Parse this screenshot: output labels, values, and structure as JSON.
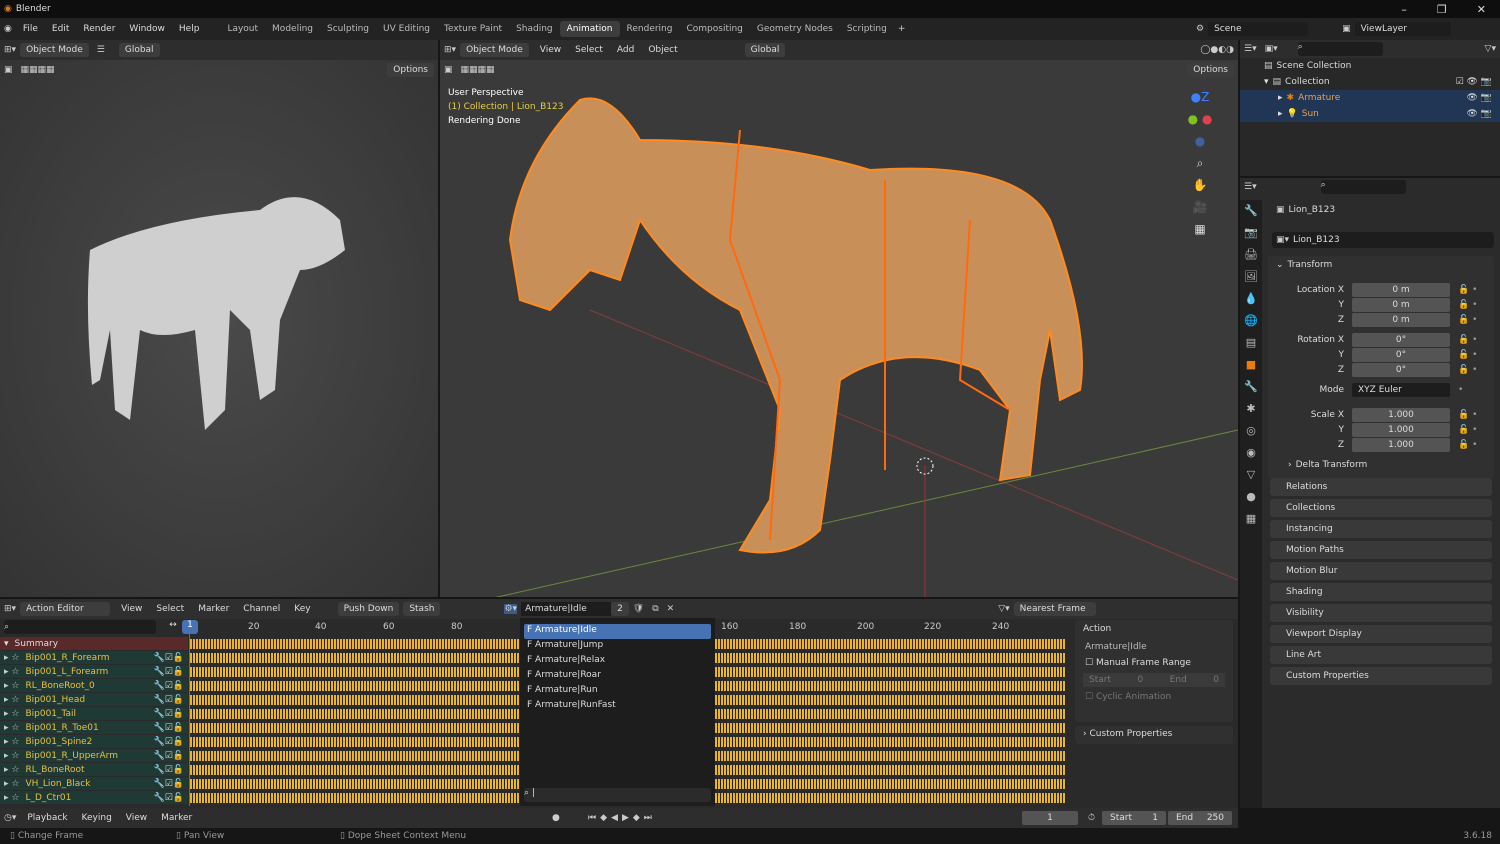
{
  "app": {
    "title": "Blender",
    "version": "3.6.18"
  },
  "menu": [
    "File",
    "Edit",
    "Render",
    "Window",
    "Help"
  ],
  "workspaces": [
    {
      "label": "Layout"
    },
    {
      "label": "Modeling"
    },
    {
      "label": "Sculpting"
    },
    {
      "label": "UV Editing"
    },
    {
      "label": "Texture Paint"
    },
    {
      "label": "Shading"
    },
    {
      "label": "Animation",
      "active": true
    },
    {
      "label": "Rendering"
    },
    {
      "label": "Compositing"
    },
    {
      "label": "Geometry Nodes"
    },
    {
      "label": "Scripting"
    }
  ],
  "scene": "Scene",
  "view_layer": "ViewLayer",
  "left_view": {
    "mode": "Object Mode",
    "orientation": "Global",
    "options": "Options"
  },
  "main_view": {
    "mode": "Object Mode",
    "menus": [
      "View",
      "Select",
      "Add",
      "Object"
    ],
    "orientation": "Global",
    "options": "Options",
    "overlay": [
      "User Perspective",
      "(1) Collection | Lion_B123",
      "Rendering Done"
    ]
  },
  "outliner": {
    "root": "Scene Collection",
    "collection": "Collection",
    "items": [
      {
        "label": "Armature"
      },
      {
        "label": "Sun"
      }
    ]
  },
  "properties": {
    "object": "Lion_B123",
    "data_name": "Lion_B123",
    "transform": "Transform",
    "location": {
      "label": "Location X",
      "x": "0 m",
      "y": "0 m",
      "z": "0 m"
    },
    "rotation": {
      "label": "Rotation X",
      "x": "0°",
      "y": "0°",
      "z": "0°"
    },
    "mode_label": "Mode",
    "mode": "XYZ Euler",
    "scale": {
      "label": "Scale X",
      "x": "1.000",
      "y": "1.000",
      "z": "1.000"
    },
    "axis_y": "Y",
    "axis_z": "Z",
    "delta": "Delta Transform",
    "sections": [
      "Relations",
      "Collections",
      "Instancing",
      "Motion Paths",
      "Motion Blur",
      "Shading",
      "Visibility",
      "Viewport Display",
      "Line Art",
      "Custom Properties"
    ]
  },
  "dopesheet": {
    "editor": "Action Editor",
    "menus": [
      "View",
      "Select",
      "Marker",
      "Channel",
      "Key"
    ],
    "push_down": "Push Down",
    "stash": "Stash",
    "action": "Armature|Idle",
    "users": "2",
    "snap": "Nearest Frame",
    "frame_ticks": [
      "20",
      "40",
      "60",
      "80",
      "160",
      "180",
      "200",
      "220",
      "240"
    ],
    "current_frame": "1",
    "summary": "Summary",
    "channels": [
      "Bip001_R_Forearm",
      "Bip001_L_Forearm",
      "RL_BoneRoot_0",
      "Bip001_Head",
      "Bip001_Tail",
      "Bip001_R_Toe01",
      "Bip001_Spine2",
      "Bip001_R_UpperArm",
      "RL_BoneRoot",
      "VH_Lion_Black",
      "L_D_Ctr01"
    ],
    "action_list": [
      "F Armature|Idle",
      "F Armature|Jump",
      "F Armature|Relax",
      "F Armature|Roar",
      "F Armature|Run",
      "F Armature|RunFast"
    ],
    "side": {
      "action": "Action",
      "name": "Armature|Idle",
      "manual": "Manual Frame Range",
      "start": "Start",
      "start_v": "0",
      "end": "End",
      "end_v": "0",
      "cyclic": "Cyclic Animation",
      "custom": "Custom Properties"
    }
  },
  "timeline": {
    "menus": [
      "Playback",
      "Keying",
      "View",
      "Marker"
    ],
    "frame": "1",
    "start_label": "Start",
    "start": "1",
    "end_label": "End",
    "end": "250"
  },
  "status": [
    "Change Frame",
    "Pan View",
    "Dope Sheet Context Menu"
  ]
}
